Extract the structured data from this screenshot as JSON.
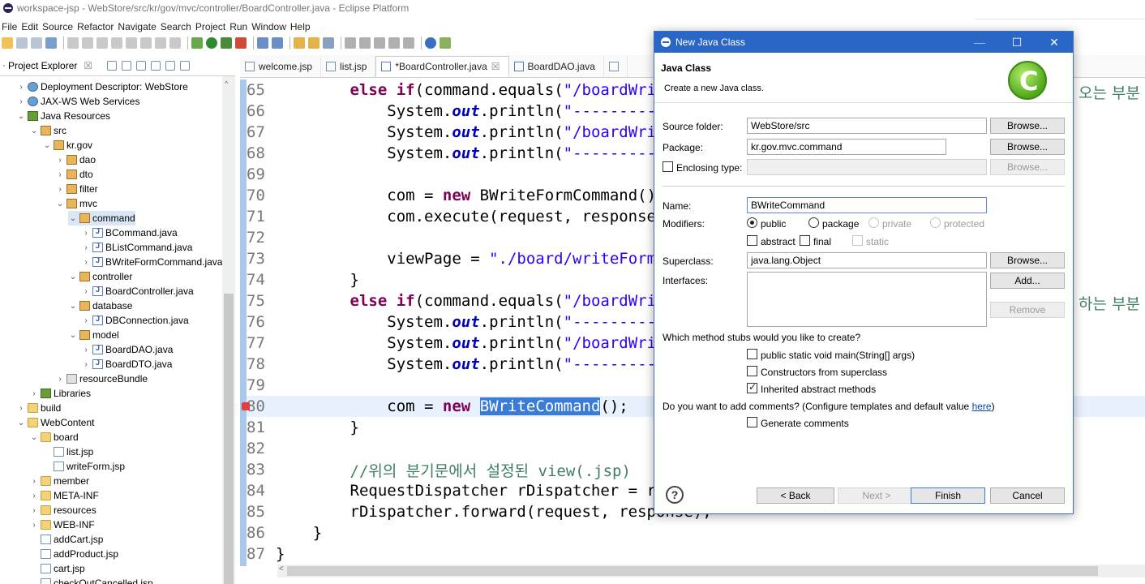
{
  "window": {
    "title": "workspace-jsp - WebStore/src/kr/gov/mvc/controller/BoardController.java - Eclipse Platform"
  },
  "menu": [
    "File",
    "Edit",
    "Source",
    "Refactor",
    "Navigate",
    "Search",
    "Project",
    "Run",
    "Window",
    "Help"
  ],
  "explorer": {
    "tab_label": "Project Explorer",
    "tree": [
      {
        "label": "Deployment Descriptor: WebStore",
        "depth": 1,
        "twisty": ">",
        "icon": "web"
      },
      {
        "label": "JAX-WS Web Services",
        "depth": 1,
        "twisty": ">",
        "icon": "web"
      },
      {
        "label": "Java Resources",
        "depth": 1,
        "twisty": "v",
        "icon": "lib"
      },
      {
        "label": "src",
        "depth": 2,
        "twisty": "v",
        "icon": "pkg"
      },
      {
        "label": "kr.gov",
        "depth": 3,
        "twisty": "v",
        "icon": "pkg"
      },
      {
        "label": "dao",
        "depth": 4,
        "twisty": ">",
        "icon": "pkg"
      },
      {
        "label": "dto",
        "depth": 4,
        "twisty": ">",
        "icon": "pkg"
      },
      {
        "label": "filter",
        "depth": 4,
        "twisty": ">",
        "icon": "pkg"
      },
      {
        "label": "mvc",
        "depth": 4,
        "twisty": "v",
        "icon": "pkg"
      },
      {
        "label": "command",
        "depth": 5,
        "twisty": "v",
        "icon": "pkg",
        "selected": true
      },
      {
        "label": "BCommand.java",
        "depth": 6,
        "twisty": ">",
        "icon": "java"
      },
      {
        "label": "BListCommand.java",
        "depth": 6,
        "twisty": ">",
        "icon": "java"
      },
      {
        "label": "BWriteFormCommand.java",
        "depth": 6,
        "twisty": ">",
        "icon": "java"
      },
      {
        "label": "controller",
        "depth": 5,
        "twisty": "v",
        "icon": "pkg"
      },
      {
        "label": "BoardController.java",
        "depth": 6,
        "twisty": ">",
        "icon": "java"
      },
      {
        "label": "database",
        "depth": 5,
        "twisty": "v",
        "icon": "pkg"
      },
      {
        "label": "DBConnection.java",
        "depth": 6,
        "twisty": ">",
        "icon": "java"
      },
      {
        "label": "model",
        "depth": 5,
        "twisty": "v",
        "icon": "pkg"
      },
      {
        "label": "BoardDAO.java",
        "depth": 6,
        "twisty": ">",
        "icon": "java"
      },
      {
        "label": "BoardDTO.java",
        "depth": 6,
        "twisty": ">",
        "icon": "java"
      },
      {
        "label": "resourceBundle",
        "depth": 4,
        "twisty": ">",
        "icon": "res"
      },
      {
        "label": "Libraries",
        "depth": 2,
        "twisty": ">",
        "icon": "lib"
      },
      {
        "label": "build",
        "depth": 1,
        "twisty": ">",
        "icon": "folder"
      },
      {
        "label": "WebContent",
        "depth": 1,
        "twisty": "v",
        "icon": "folder"
      },
      {
        "label": "board",
        "depth": 2,
        "twisty": "v",
        "icon": "folder"
      },
      {
        "label": "list.jsp",
        "depth": 3,
        "twisty": "",
        "icon": "jsp"
      },
      {
        "label": "writeForm.jsp",
        "depth": 3,
        "twisty": "",
        "icon": "jsp"
      },
      {
        "label": "member",
        "depth": 2,
        "twisty": ">",
        "icon": "folder"
      },
      {
        "label": "META-INF",
        "depth": 2,
        "twisty": ">",
        "icon": "folder"
      },
      {
        "label": "resources",
        "depth": 2,
        "twisty": ">",
        "icon": "folder"
      },
      {
        "label": "WEB-INF",
        "depth": 2,
        "twisty": ">",
        "icon": "folder"
      },
      {
        "label": "addCart.jsp",
        "depth": 2,
        "twisty": "",
        "icon": "jsp"
      },
      {
        "label": "addProduct.jsp",
        "depth": 2,
        "twisty": "",
        "icon": "jsp"
      },
      {
        "label": "cart.jsp",
        "depth": 2,
        "twisty": "",
        "icon": "jsp"
      },
      {
        "label": "checkOutCancelled.jsp",
        "depth": 2,
        "twisty": "",
        "icon": "jsp"
      }
    ]
  },
  "editor": {
    "tabs": [
      "welcome.jsp",
      "list.jsp",
      "*BoardController.java",
      "BoardDAO.java"
    ],
    "active_tab": 2,
    "korean_1": "오는 부분",
    "korean_2": "하는 부분"
  },
  "dialog": {
    "title": "New Java Class",
    "heading": "Java Class",
    "subheading": "Create a new Java class.",
    "source_folder_label": "Source folder:",
    "source_folder_value": "WebStore/src",
    "package_label": "Package:",
    "package_value": "kr.gov.mvc.command",
    "enclosing_label": "Enclosing type:",
    "name_label": "Name:",
    "name_value": "BWriteCommand",
    "modifiers_label": "Modifiers:",
    "mod_public": "public",
    "mod_package": "package",
    "mod_private": "private",
    "mod_protected": "protected",
    "mod_abstract": "abstract",
    "mod_final": "final",
    "mod_static": "static",
    "superclass_label": "Superclass:",
    "superclass_value": "java.lang.Object",
    "interfaces_label": "Interfaces:",
    "browse": "Browse...",
    "add": "Add...",
    "remove": "Remove",
    "stubs_question": "Which method stubs would you like to create?",
    "stub_main": "public static void main(String[] args)",
    "stub_ctor": "Constructors from superclass",
    "stub_inherited": "Inherited abstract methods",
    "comments_question": "Do you want to add comments? (Configure templates and default value ",
    "comments_link": "here",
    "comments_close": ")",
    "gen_comments": "Generate comments",
    "back": "< Back",
    "next": "Next >",
    "finish": "Finish",
    "cancel": "Cancel"
  }
}
